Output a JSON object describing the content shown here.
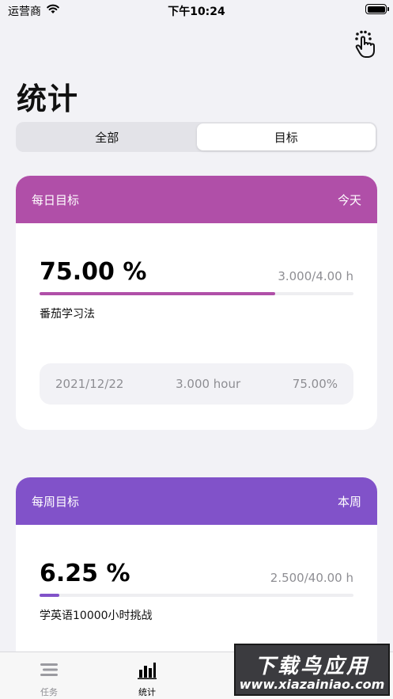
{
  "status_bar": {
    "carrier": "运营商",
    "time": "下午10:24"
  },
  "page": {
    "title": "统计"
  },
  "segment": {
    "items": [
      {
        "label": "全部"
      },
      {
        "label": "目标"
      }
    ],
    "selected": "目标"
  },
  "daily_card": {
    "title": "每日目标",
    "period": "今天",
    "percent": "75.00 %",
    "hours": "3.000/4.00 h",
    "progress": 0.75,
    "goal_name": "番茄学习法",
    "accent": "#b04fa8",
    "history": [
      {
        "date": "2021/12/22",
        "hours": "3.000 hour",
        "percent": "75.00%"
      }
    ]
  },
  "weekly_card": {
    "title": "每周目标",
    "period": "本周",
    "percent": "6.25 %",
    "hours": "2.500/40.00 h",
    "progress": 0.0625,
    "goal_name": "学英语10000小时挑战",
    "accent": "#8152c9"
  },
  "tab_bar": {
    "items": [
      {
        "label": "任务",
        "icon": "list-icon",
        "active": false
      },
      {
        "label": "统计",
        "icon": "bar-chart-icon",
        "active": true
      }
    ]
  },
  "watermark": {
    "main": "下载鸟应用",
    "url": "www.xiazainiao.com"
  }
}
